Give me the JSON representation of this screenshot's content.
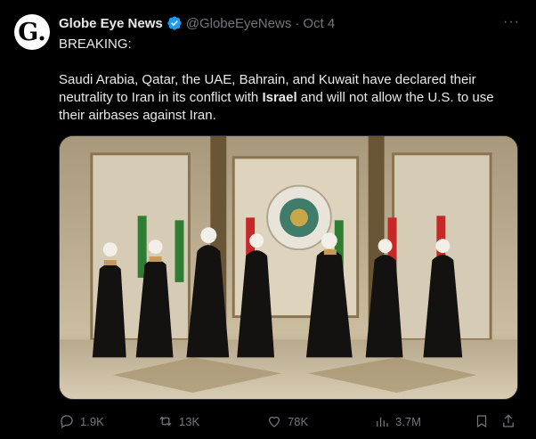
{
  "tweet": {
    "author_name": "Globe Eye News",
    "handle": "@GlobeEyeNews",
    "separator": "·",
    "date": "Oct 4",
    "avatar_letter": "G.",
    "verified_icon": "verified-badge-icon",
    "line1": "BREAKING:",
    "para_before": "Saudi Arabia, Qatar, the UAE, Bahrain, and Kuwait have declared their neutrality to Iran in its conflict with ",
    "highlight": "Israel",
    "para_after": " and will not allow the U.S. to use their airbases against Iran.",
    "more_label": "···",
    "colors": {
      "accent": "#1d9bf0",
      "text": "#e7e9ea",
      "muted": "#71767b",
      "background": "#000000"
    }
  },
  "actions": {
    "replies": "1.9K",
    "retweets": "13K",
    "likes": "78K",
    "views": "3.7M"
  }
}
